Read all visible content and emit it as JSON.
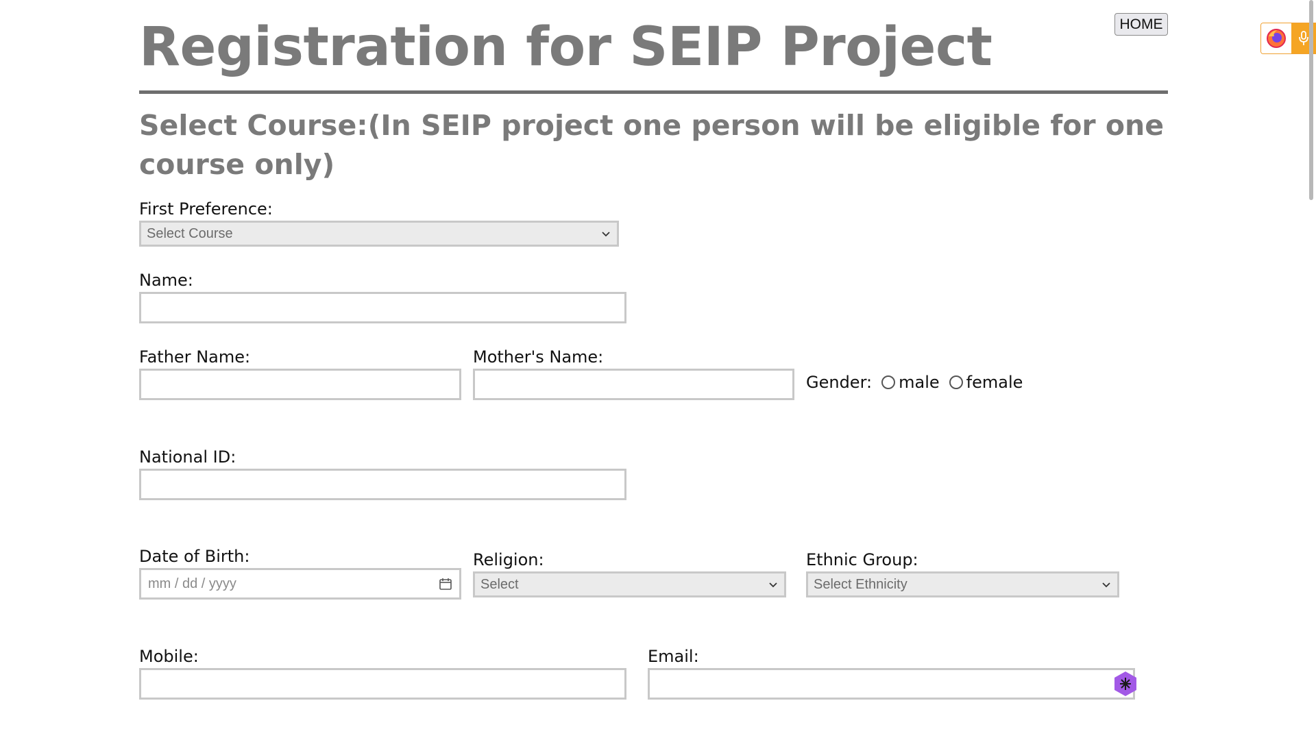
{
  "header": {
    "title": "Registration for SEIP Project",
    "home_label": "HOME"
  },
  "section": {
    "heading": "Select Course:(In SEIP project one person will be eligible for one course only)"
  },
  "form": {
    "first_preference": {
      "label": "First Preference:",
      "value": "Select Course"
    },
    "name": {
      "label": "Name:",
      "value": ""
    },
    "father_name": {
      "label": "Father Name:",
      "value": ""
    },
    "mother_name": {
      "label": "Mother's Name:",
      "value": ""
    },
    "gender": {
      "label": "Gender:",
      "options": [
        "male",
        "female"
      ]
    },
    "national_id": {
      "label": "National ID:",
      "value": ""
    },
    "dob": {
      "label": "Date of Birth:",
      "placeholder": "mm / dd / yyyy"
    },
    "religion": {
      "label": "Religion:",
      "value": "Select"
    },
    "ethnic_group": {
      "label": "Ethnic Group:",
      "value": "Select Ethnicity"
    },
    "mobile": {
      "label": "Mobile:",
      "value": ""
    },
    "email": {
      "label": "Email:",
      "value": ""
    }
  },
  "icons": {
    "browser_extension": "firefox-icon",
    "voice": "microphone-icon",
    "calendar": "calendar-icon",
    "assistant": "assistant-icon",
    "dropdown": "chevron-down-icon"
  },
  "colors": {
    "title": "#7a7a7a",
    "input_border": "#c8c8c8",
    "select_bg": "#ebebeb",
    "extension_accent": "#f5a524",
    "assistant": "#a259e6"
  }
}
